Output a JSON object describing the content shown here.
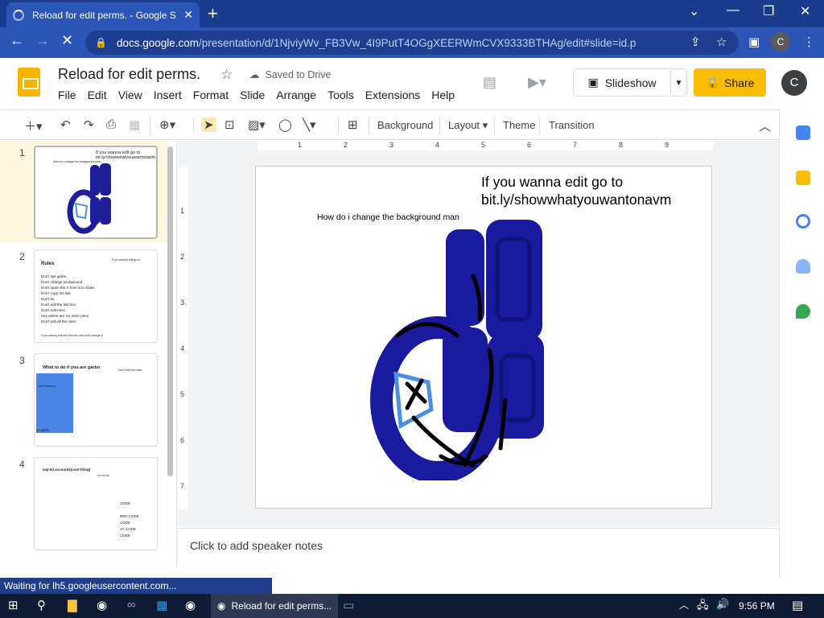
{
  "browser": {
    "tab_title": "Reload for edit perms. - Google S",
    "url_host": "docs.google.com",
    "url_path": "/presentation/d/1NjviyWv_FB3Vw_4I9PutT4OGgXEERWmCVX9333BTHAg/edit#slide=id.p",
    "profile_initial": "C",
    "status": "Waiting for lh5.googleusercontent.com..."
  },
  "app": {
    "doc_title": "Reload for edit perms.",
    "saved_label": "Saved to Drive",
    "menu": [
      "File",
      "Edit",
      "View",
      "Insert",
      "Format",
      "Slide",
      "Arrange",
      "Tools",
      "Extensions",
      "Help"
    ],
    "slideshow_label": "Slideshow",
    "share_label": "Share",
    "user_initial": "C"
  },
  "toolbar": {
    "background_label": "Background",
    "layout_label": "Layout",
    "theme_label": "Theme",
    "transition_label": "Transition"
  },
  "rulers": {
    "h_ticks": [
      "1",
      "2",
      "3",
      "4",
      "5",
      "6",
      "7",
      "8",
      "9"
    ],
    "v_ticks": [
      "1",
      "2",
      "3",
      "4",
      "5",
      "6",
      "7"
    ]
  },
  "filmstrip": [
    {
      "num": "1",
      "title_line1": "If you wanna edit go to",
      "title_line2": "bit.ly/showwhatyouwantonavm",
      "sub": "How do i change the background man"
    },
    {
      "num": "2",
      "title": "Rules",
      "note": "If you wanna edit go to",
      "lines": [
        "Don't spit garbo",
        "Don't change background",
        "Don't spam the X from X to slides",
        "Don't copy the link",
        "Don't lie",
        "Don't edit the last box",
        "Don't edit rules",
        "Hey where are my other rules",
        "Don't edit all the rules"
      ],
      "footer": "If you wanna edit see this box and don't change it"
    },
    {
      "num": "3",
      "title": "What to do if you are garbo",
      "note": "Don't edit this slide",
      "box_label": "Don't Remove",
      "bottom": "ur garbo"
    },
    {
      "num": "4",
      "title": "zap'ed accounts(cool thing)",
      "note": "no not ok",
      "lines": [
        "CODE",
        "RED CODE",
        "CODE",
        "AY CODE",
        "CODE"
      ]
    }
  ],
  "slide": {
    "title_line1": "If you wanna edit go to",
    "title_line2": "bit.ly/showwhatyouwantonavm",
    "subtitle": "How do i change the background man"
  },
  "notes": {
    "placeholder": "Click to add speaker notes"
  },
  "taskbar": {
    "active_app": "Reload for edit perms...",
    "time": "9:56 PM"
  }
}
